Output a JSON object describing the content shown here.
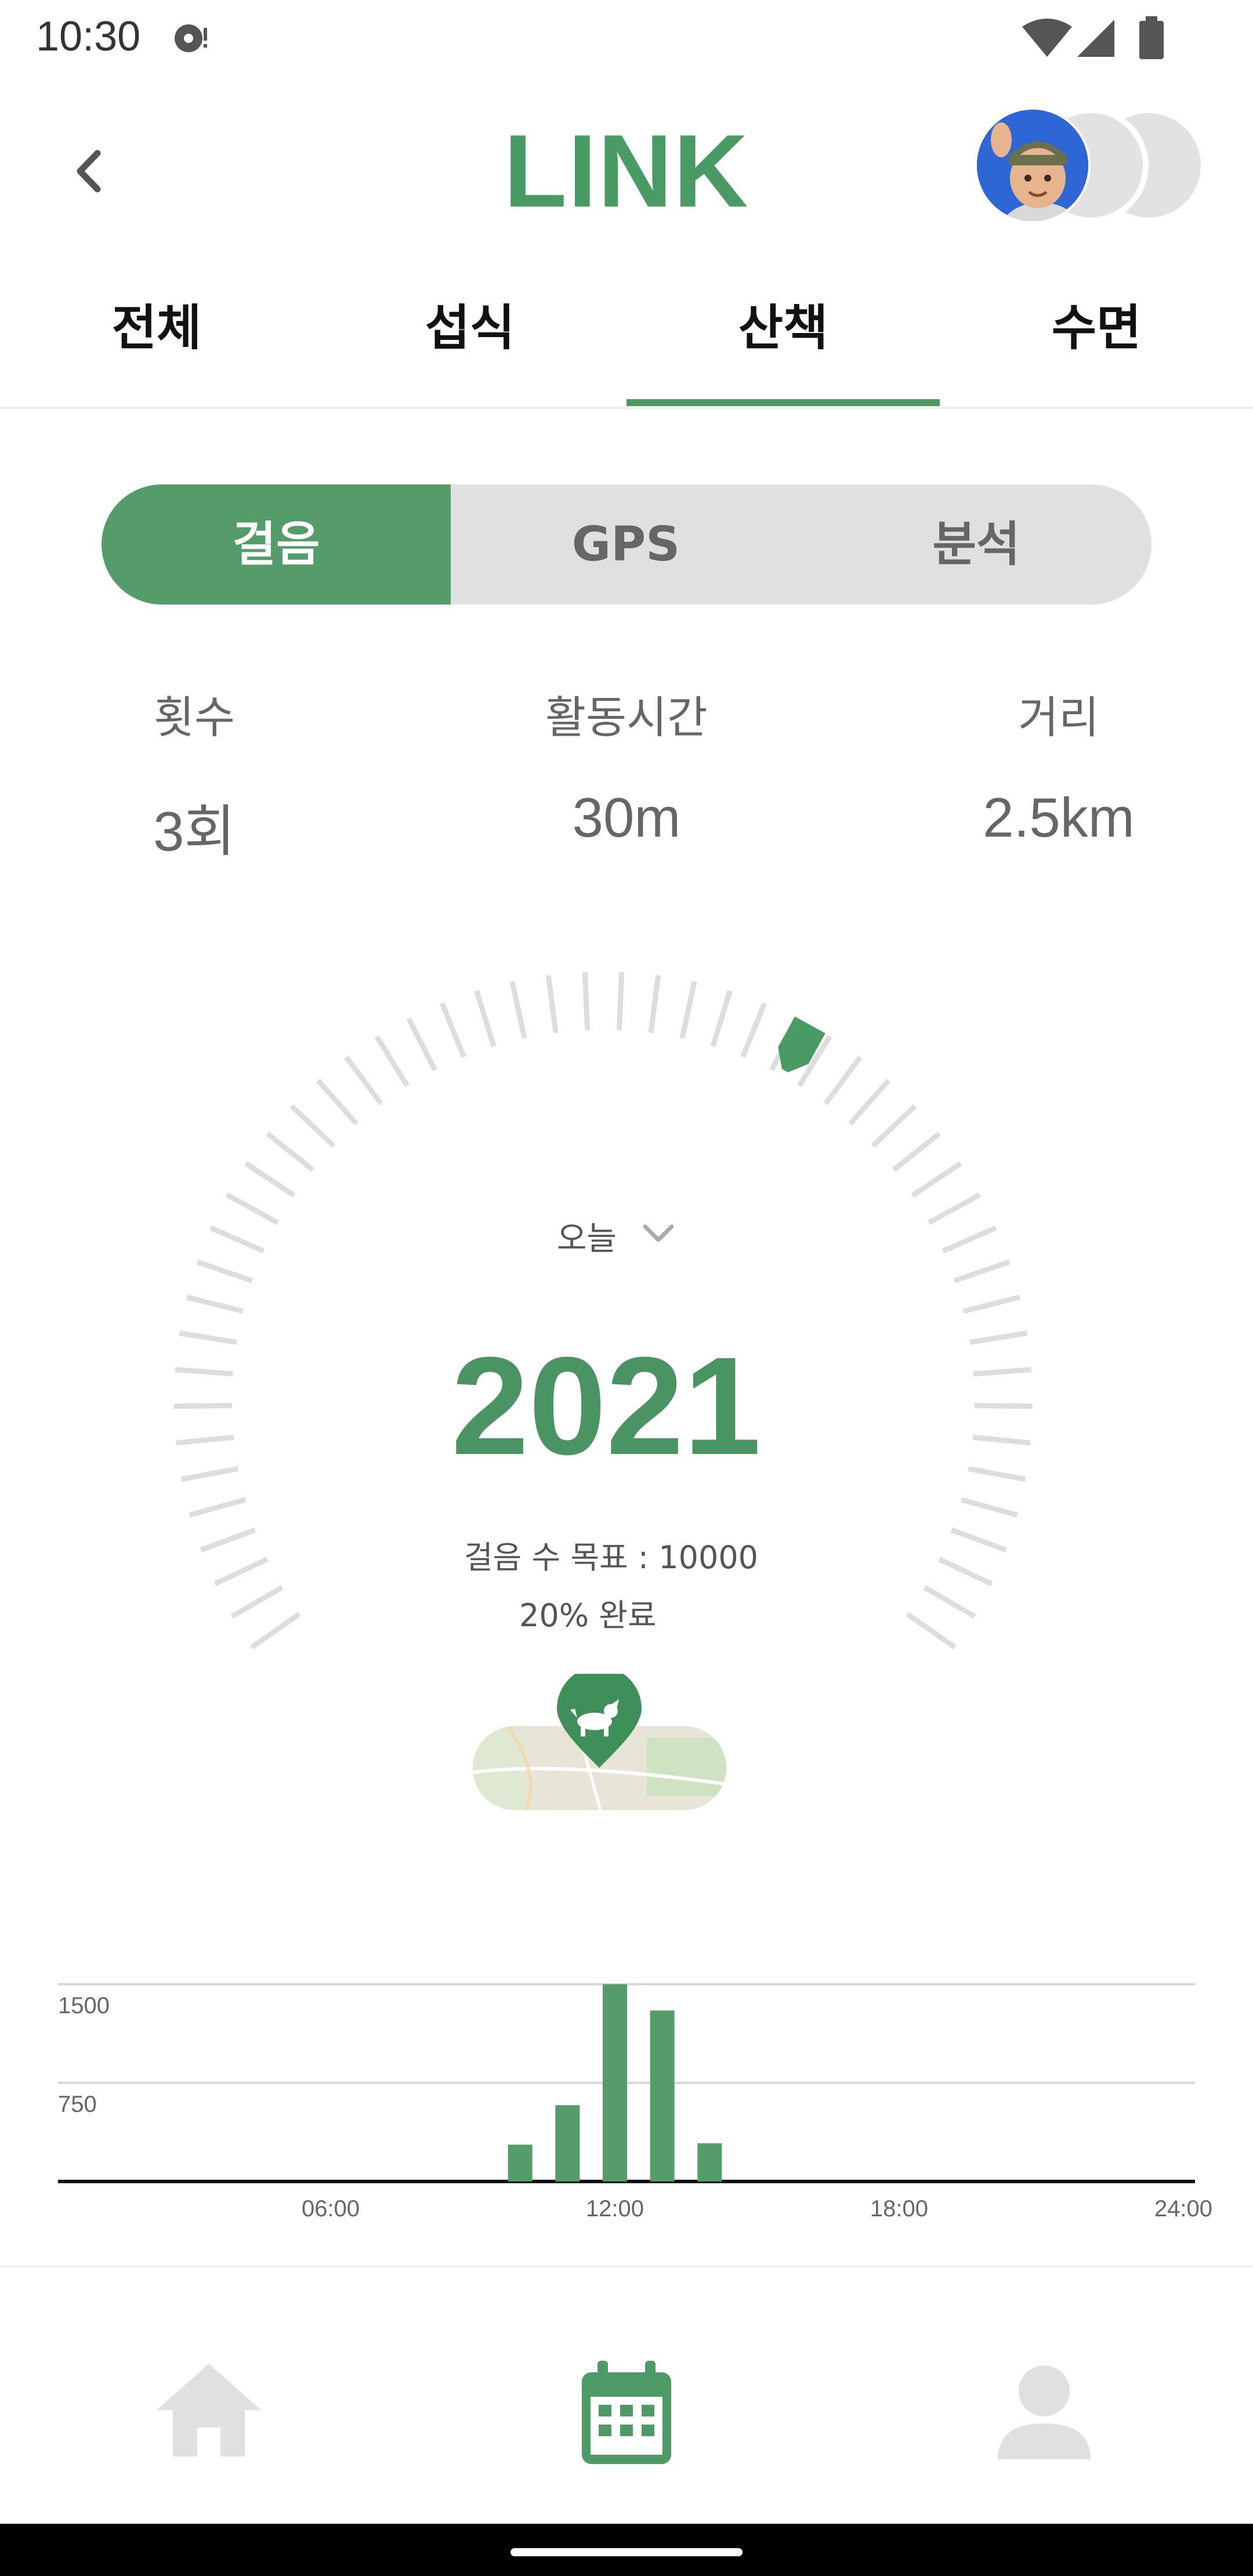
{
  "status_bar": {
    "time": "10:30"
  },
  "header": {
    "title": "LINK"
  },
  "tabs": [
    {
      "label": "전체"
    },
    {
      "label": "섭식"
    },
    {
      "label": "산책"
    },
    {
      "label": "수면"
    }
  ],
  "active_tab": "산책",
  "segments": [
    {
      "label": "걸음"
    },
    {
      "label": "GPS"
    },
    {
      "label": "분석"
    }
  ],
  "active_segment": "걸음",
  "stats": [
    {
      "label": "횟수",
      "value": "3회"
    },
    {
      "label": "활동시간",
      "value": "30m"
    },
    {
      "label": "거리",
      "value": "2.5km"
    }
  ],
  "gauge": {
    "period": "오늘",
    "steps": "2021",
    "goal_text": "걸음 수 목표 : 10000",
    "done_text": "20% 완료",
    "progress": 0.2
  },
  "chart_data": {
    "type": "bar",
    "x_ticks": [
      "06:00",
      "12:00",
      "18:00",
      "24:00"
    ],
    "y_ticks": [
      "1500",
      "750"
    ],
    "ylim": [
      0,
      1500
    ],
    "xlim": [
      0,
      24
    ],
    "bars": [
      {
        "x": 10,
        "value": 280
      },
      {
        "x": 11,
        "value": 580
      },
      {
        "x": 12,
        "value": 1500
      },
      {
        "x": 13,
        "value": 1300
      },
      {
        "x": 14,
        "value": 290
      }
    ],
    "bar_color": "#559c6b"
  },
  "colors": {
    "accent": "#4a9a63",
    "tick": "#dddddd",
    "inactive": "#e0e0e0"
  },
  "icons": {
    "back": "chevron-left-icon",
    "home": "home-icon",
    "calendar": "calendar-icon",
    "profile": "person-icon",
    "map_pin": "dog-pin-icon"
  }
}
